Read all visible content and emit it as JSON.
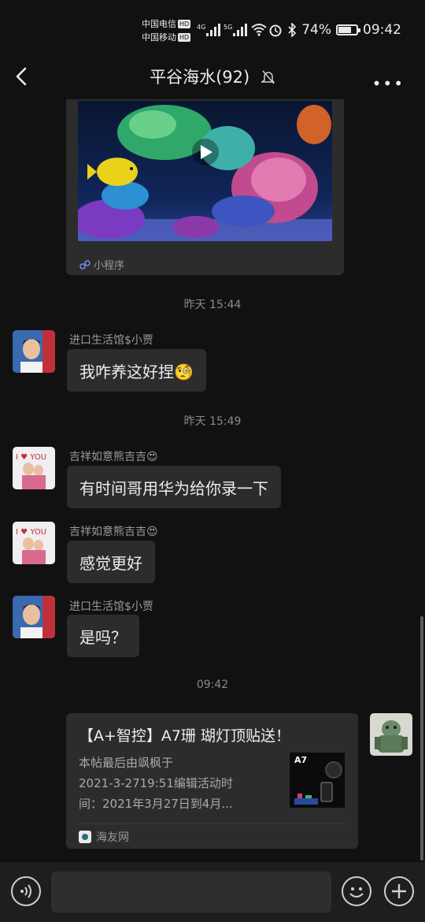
{
  "status_bar": {
    "carrier1": "中国电信",
    "carrier2": "中国移动",
    "hd_badge": "HD",
    "network1": "4G",
    "network2": "5G",
    "battery_percent": "74%",
    "battery_level": 0.74,
    "clock": "09:42"
  },
  "header": {
    "title": "平谷海水(92)",
    "more": "•••"
  },
  "messages": {
    "mini_program_label": "小程序",
    "time1": "昨天 15:44",
    "msg1": {
      "sender": "进口生活馆$小贾",
      "text": "我咋养这好捏🧐"
    },
    "time2": "昨天 15:49",
    "msg2": {
      "sender": "吉祥如意熊吉吉😍",
      "text": "有时间哥用华为给你录一下"
    },
    "msg3": {
      "sender": "吉祥如意熊吉吉😍",
      "text": "感觉更好"
    },
    "msg4": {
      "sender": "进口生活馆$小贾",
      "text": "是吗？"
    },
    "time3": "09:42",
    "link_card": {
      "title": "【A+智控】A7珊 瑚灯顶贴送！",
      "desc_line1": "本帖最后由飒枫于",
      "desc_line2": "2021-3-2719:51编辑活动时",
      "desc_line3": "间：2021年3月27日到4月...",
      "thumb_label": "A7",
      "source": "海友网"
    }
  },
  "input": {
    "placeholder": ""
  }
}
